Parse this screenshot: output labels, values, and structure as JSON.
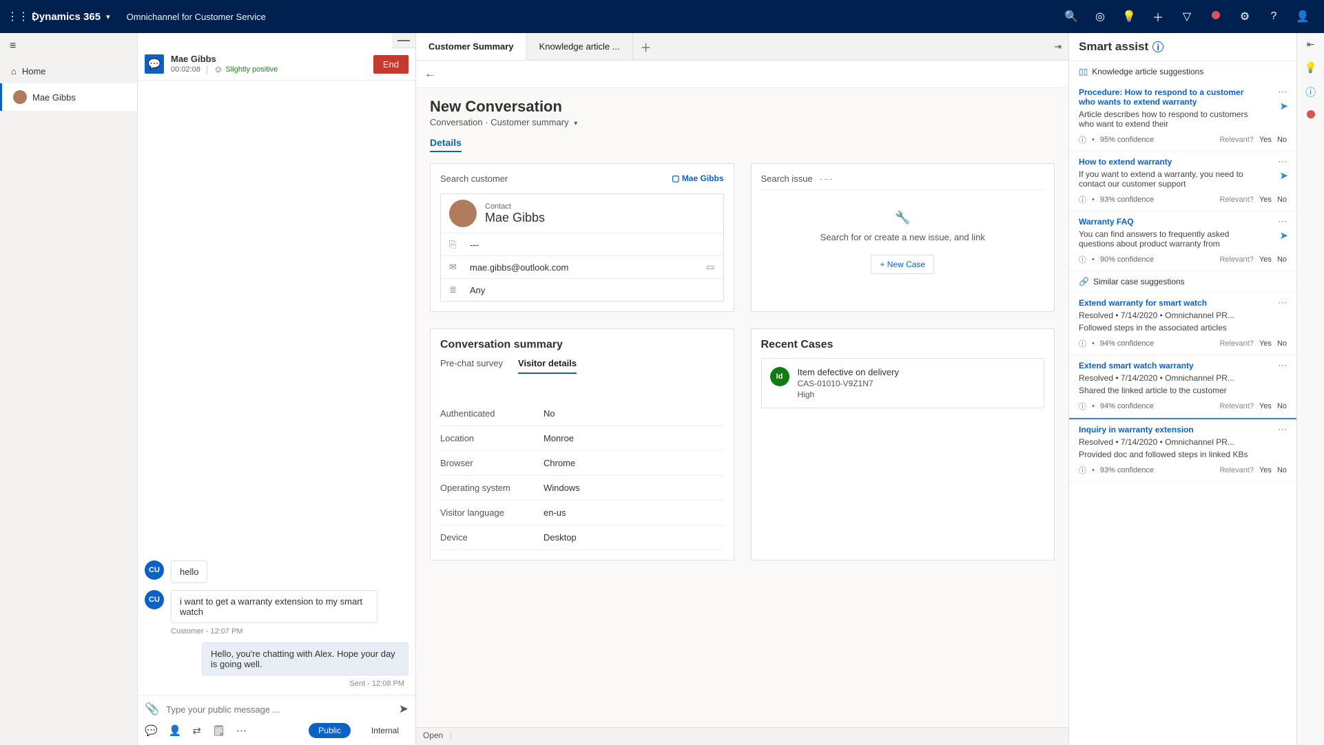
{
  "topbar": {
    "brand": "Dynamics 365",
    "app": "Omnichannel for Customer Service"
  },
  "nav": {
    "home": "Home",
    "contact": "Mae Gibbs"
  },
  "session": {
    "name": "Mae Gibbs",
    "timer": "00:02:08",
    "sentiment": "Slightly positive",
    "end": "End",
    "messages": [
      {
        "who": "cu",
        "avatar": "CU",
        "text": "hello"
      },
      {
        "who": "cu",
        "avatar": "CU",
        "text": "i want to get a warranty extension to my smart watch",
        "meta": "Customer - 12:07 PM"
      },
      {
        "who": "agent",
        "text": "Hello, you're chatting with Alex. Hope your day is going well.",
        "meta": "Sent - 12:08 PM"
      }
    ],
    "composer_placeholder": "Type your public message ...",
    "public": "Public",
    "internal": "Internal"
  },
  "tabs": {
    "t1": "Customer Summary",
    "t2": "Knowledge article ..."
  },
  "page": {
    "title": "New Conversation",
    "sub1": "Conversation",
    "sub2": "Customer summary",
    "details": "Details"
  },
  "customer_card": {
    "search": "Search customer",
    "link": "Mae Gibbs",
    "contact_label": "Contact",
    "contact_name": "Mae Gibbs",
    "line1": "---",
    "email": "mae.gibbs@outlook.com",
    "line3": "Any"
  },
  "issue_card": {
    "head": "Search issue",
    "empty": "Search for or create a new issue, and link",
    "newcase": "+ New Case"
  },
  "conv": {
    "title": "Conversation summary",
    "tab1": "Pre-chat survey",
    "tab2": "Visitor details",
    "rows": [
      {
        "k": "Authenticated",
        "v": "No"
      },
      {
        "k": "Location",
        "v": "Monroe"
      },
      {
        "k": "Browser",
        "v": "Chrome"
      },
      {
        "k": "Operating system",
        "v": "Windows"
      },
      {
        "k": "Visitor language",
        "v": "en-us"
      },
      {
        "k": "Device",
        "v": "Desktop"
      }
    ]
  },
  "recent": {
    "title": "Recent Cases",
    "case": {
      "badge": "Id",
      "title": "Item defective on delivery",
      "num": "CAS-01010-V9Z1N7",
      "priority": "High"
    }
  },
  "status": "Open",
  "smart": {
    "title": "Smart assist",
    "section1": "Knowledge article suggestions",
    "section2": "Similar case suggestions",
    "relevant": "Relevant?",
    "yes": "Yes",
    "no": "No",
    "kas": [
      {
        "title": "Procedure: How to respond to a customer who wants to extend warranty",
        "desc": "Article describes how to respond to customers who want to extend their",
        "conf": "95% confidence"
      },
      {
        "title": "How to extend warranty",
        "desc": "If you want to extend a warranty, you need to contact our customer support",
        "conf": "93% confidence"
      },
      {
        "title": "Warranty FAQ",
        "desc": "You can find answers to frequently asked questions about product warranty from",
        "conf": "90% confidence"
      }
    ],
    "scs": [
      {
        "title": "Extend warranty for smart watch",
        "meta": "Resolved • 7/14/2020 • Omnichannel PR...",
        "desc": "Followed steps in the associated articles",
        "conf": "94% confidence"
      },
      {
        "title": "Extend smart watch warranty",
        "meta": "Resolved • 7/14/2020 • Omnichannel PR...",
        "desc": "Shared the linked article to the customer",
        "conf": "94% confidence"
      },
      {
        "title": "Inquiry in warranty extension",
        "meta": "Resolved • 7/14/2020 • Omnichannel PR...",
        "desc": "Provided doc and followed steps in linked KBs",
        "conf": "93% confidence"
      }
    ]
  }
}
